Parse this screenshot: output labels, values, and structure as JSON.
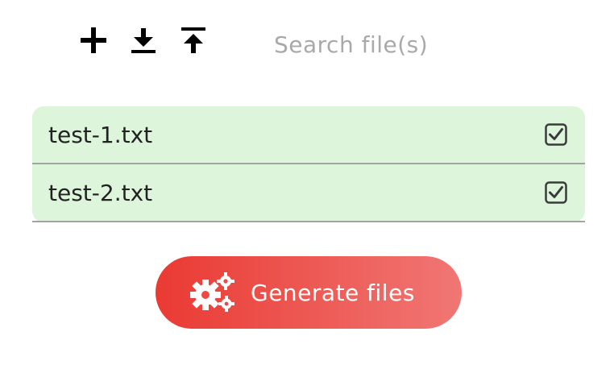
{
  "toolbar": {
    "buttons": [
      {
        "icon": "plus-icon"
      },
      {
        "icon": "download-icon"
      },
      {
        "icon": "upload-icon"
      }
    ]
  },
  "search": {
    "placeholder": "Search file(s)",
    "value": ""
  },
  "files": [
    {
      "name": "test-1.txt",
      "checked": true
    },
    {
      "name": "test-2.txt",
      "checked": true
    }
  ],
  "generate": {
    "label": "Generate files",
    "icon": "gears-icon"
  },
  "colors": {
    "list_background": "#ddf5db",
    "button_gradient_start": "#ea3a33",
    "button_gradient_end": "#f07774"
  }
}
